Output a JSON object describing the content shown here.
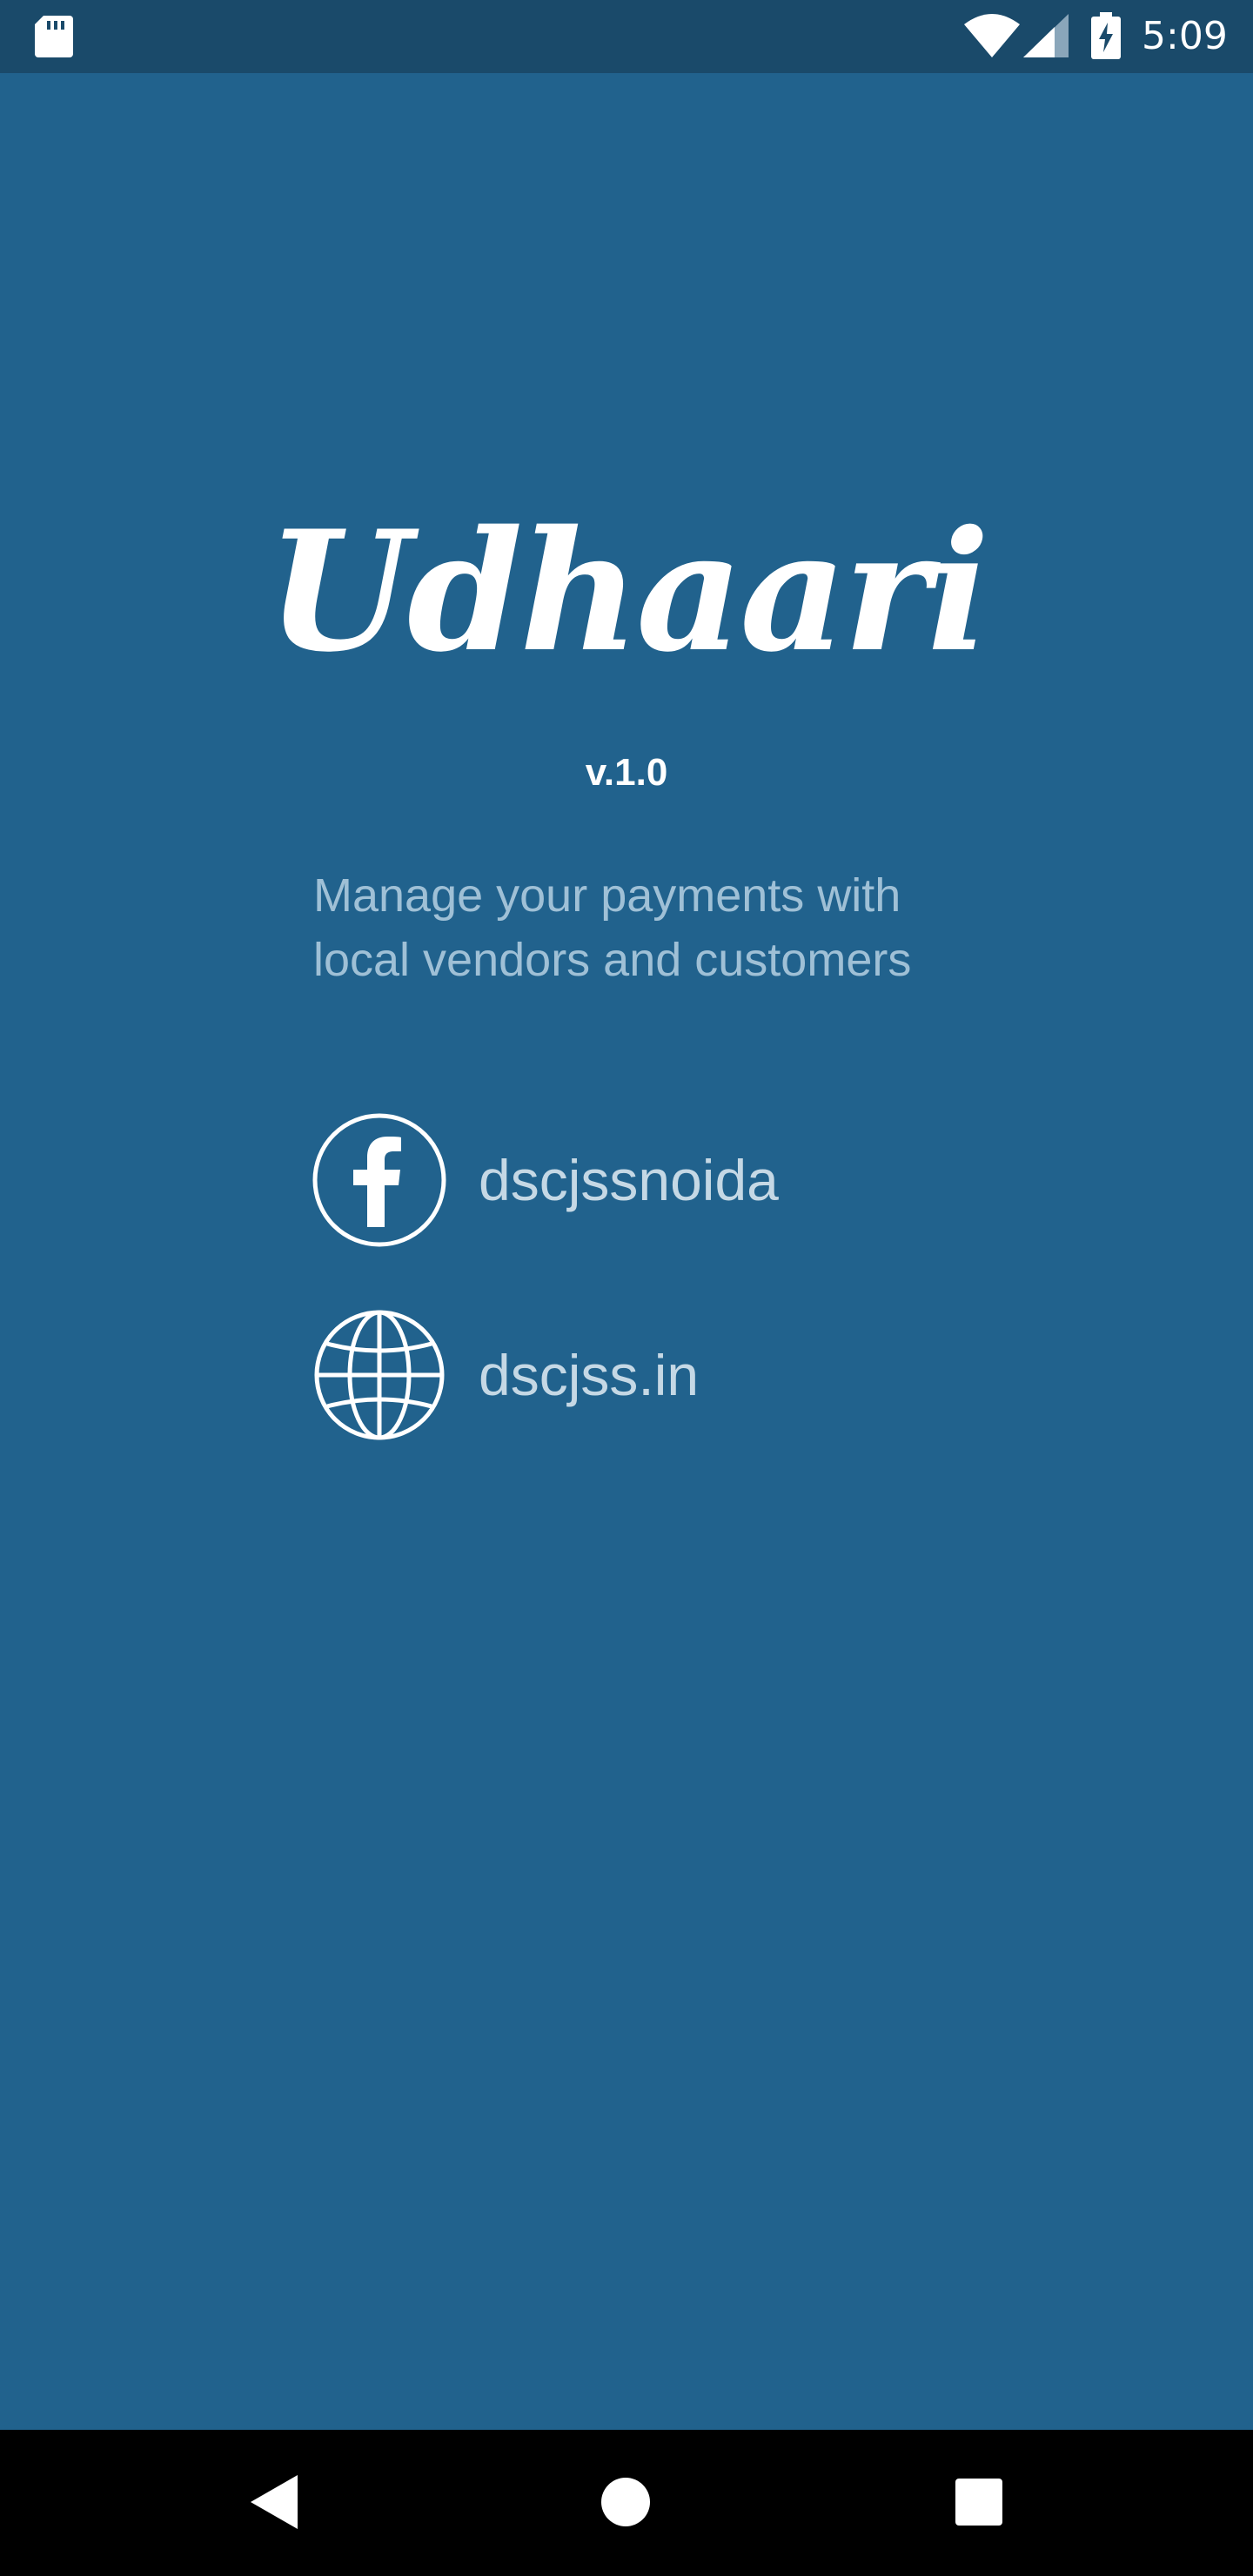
{
  "status_bar": {
    "time": "5:09",
    "icons": [
      "sd-card-icon",
      "wifi-icon",
      "cell-signal-icon",
      "battery-charging-icon"
    ]
  },
  "app": {
    "title": "Udhaari",
    "version": "v.1.0",
    "tagline_line1": "Manage your payments with",
    "tagline_line2": "local vendors and customers"
  },
  "links": {
    "facebook": {
      "icon": "facebook-icon",
      "label": "dscjssnoida"
    },
    "website": {
      "icon": "globe-icon",
      "label": "dscjss.in"
    }
  },
  "nav_bar": {
    "icons": [
      "back-icon",
      "home-icon",
      "recents-icon"
    ]
  },
  "colors": {
    "background": "#21628d",
    "status_bar": "#1a4a6a",
    "tagline": "#9fc0d6",
    "link_text": "#c5d8e5",
    "nav_bar": "#000000"
  }
}
